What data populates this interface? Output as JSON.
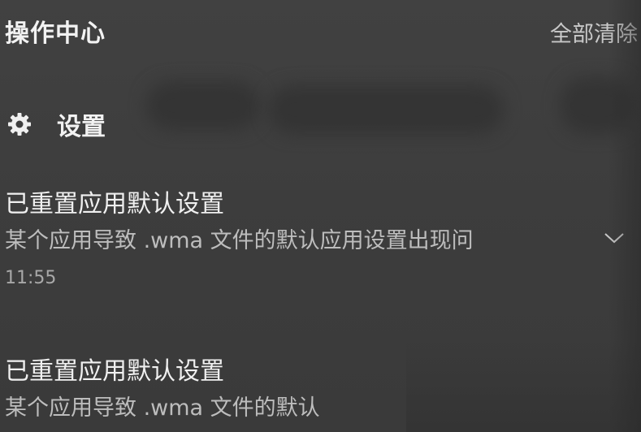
{
  "header": {
    "title": "操作中心",
    "clear_all_label": "全部清除"
  },
  "group": {
    "icon": "gear-icon",
    "label": "设置"
  },
  "notifications": [
    {
      "title": "已重置应用默认设置",
      "body": "某个应用导致 .wma 文件的默认应用设置出现问",
      "time": "11:55",
      "expand_icon": "chevron-down-icon"
    },
    {
      "title": "已重置应用默认设置",
      "body": "某个应用导致 .wma 文件的默认"
    }
  ],
  "colors": {
    "background": "#3e3e3e",
    "text_primary": "#f0f0f0",
    "text_secondary": "#bdbdbd"
  }
}
